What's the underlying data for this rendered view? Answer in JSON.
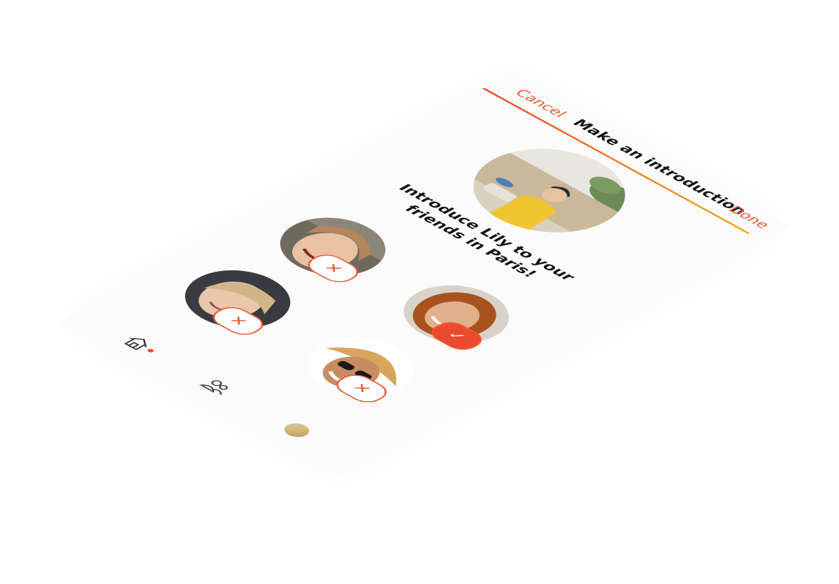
{
  "nav": {
    "cancel_label": "Cancel",
    "title": "Make an introduction",
    "done_label": "Done"
  },
  "hero": {
    "avatar_name": "Lily"
  },
  "prompt": "Introduce Lily to your friends in Paris!",
  "friends": [
    {
      "id": "friend-1",
      "state": "unselected",
      "badge_icon": "close-icon",
      "badge_glyph": "✕"
    },
    {
      "id": "friend-2",
      "state": "selected",
      "badge_icon": "check-icon",
      "badge_glyph": "✓"
    },
    {
      "id": "friend-3",
      "state": "unselected",
      "badge_icon": "close-icon",
      "badge_glyph": "✕"
    },
    {
      "id": "friend-4",
      "state": "unselected",
      "badge_icon": "close-icon",
      "badge_glyph": "✕"
    }
  ],
  "tabbar": {
    "items": [
      {
        "icon": "home-icon",
        "active": true
      },
      {
        "icon": "people-icon",
        "active": false
      },
      {
        "icon": "profile-avatar",
        "active": false
      }
    ]
  },
  "colors": {
    "accent": "#ec4a2f",
    "accent_gradient_end": "#f5a623",
    "text": "#151515",
    "background": "#fbfbfb"
  }
}
